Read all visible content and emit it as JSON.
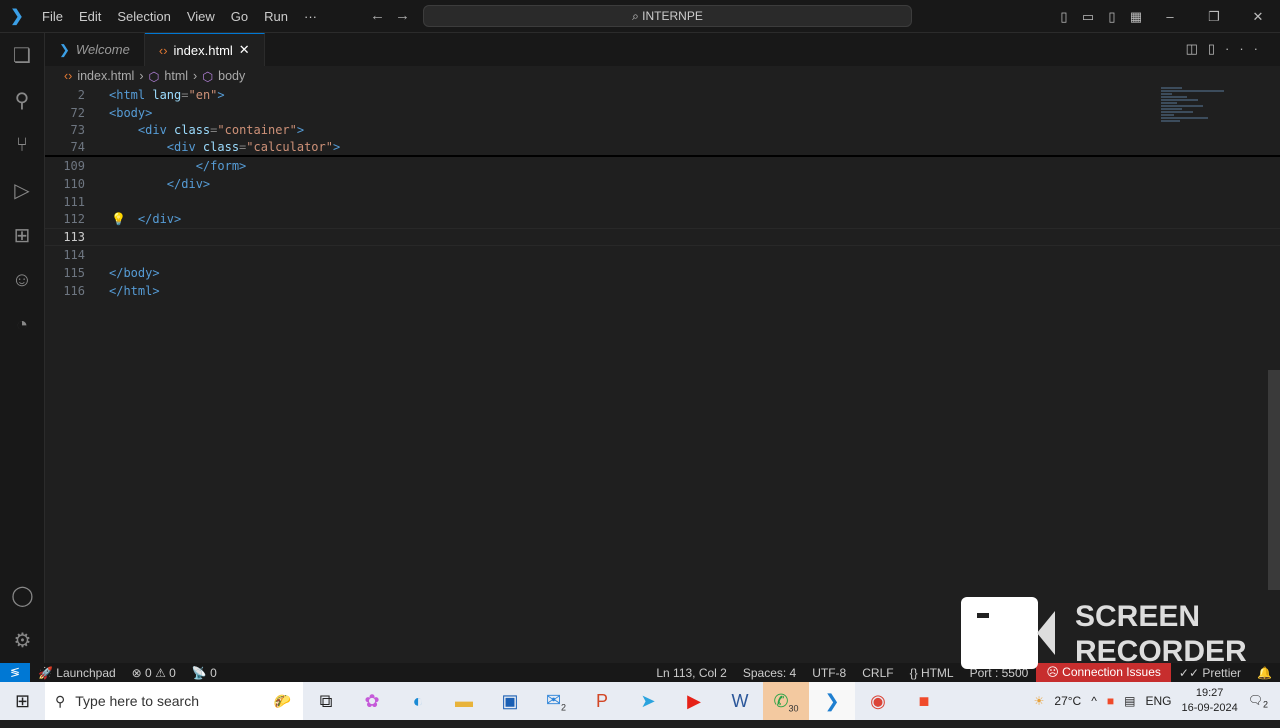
{
  "menu": [
    "File",
    "Edit",
    "Selection",
    "View",
    "Go",
    "Run",
    "···"
  ],
  "command_center": "⌕ INTERNPE",
  "tabs": [
    {
      "label": "Welcome"
    },
    {
      "label": "index.html",
      "close": "✕"
    }
  ],
  "breadcrumb": [
    "index.html",
    "html",
    "body"
  ],
  "lines": [
    {
      "n": "2",
      "parts": [
        [
          "tag",
          "<html "
        ],
        [
          "attr",
          "lang"
        ],
        [
          "br",
          "="
        ],
        [
          "str",
          "\"en\""
        ],
        [
          "tag",
          ">"
        ]
      ]
    },
    {
      "n": "72",
      "parts": [
        [
          "tag",
          "<body>"
        ]
      ]
    },
    {
      "n": "73",
      "parts": [
        [
          "tag",
          "    <div "
        ],
        [
          "attr",
          "class"
        ],
        [
          "br",
          "="
        ],
        [
          "str",
          "\"container\""
        ],
        [
          "tag",
          ">"
        ]
      ]
    },
    {
      "n": "74",
      "parts": [
        [
          "tag",
          "        <div "
        ],
        [
          "attr",
          "class"
        ],
        [
          "br",
          "="
        ],
        [
          "str",
          "\"calculator\""
        ],
        [
          "tag",
          ">"
        ]
      ]
    },
    {
      "n": "109",
      "parts": [
        [
          "tag",
          "            </form>"
        ]
      ]
    },
    {
      "n": "110",
      "parts": [
        [
          "tag",
          "        </div>"
        ]
      ]
    },
    {
      "n": "111",
      "parts": []
    },
    {
      "n": "112",
      "parts": [
        [
          "tag",
          "    </div>"
        ]
      ]
    },
    {
      "n": "113",
      "parts": []
    },
    {
      "n": "114",
      "parts": []
    },
    {
      "n": "115",
      "parts": [
        [
          "tag",
          "</body>"
        ]
      ]
    },
    {
      "n": "116",
      "parts": [
        [
          "tag",
          "</html>"
        ]
      ]
    }
  ],
  "status": {
    "launchpad": "Launchpad",
    "problems": "⊗ 0 ⚠ 0",
    "ports": "0",
    "position": "Ln 113, Col 2",
    "spaces": "Spaces: 4",
    "encoding": "UTF-8",
    "eol": "CRLF",
    "language": "HTML",
    "port": "Port : 5500",
    "connection": "Connection Issues",
    "prettier": "Prettier"
  },
  "taskbar": {
    "search_placeholder": "Type here to search",
    "mail_badge": "2",
    "whatsapp_badge": "30",
    "weather": "27°C",
    "lang": "ENG",
    "time": "19:27",
    "date": "16-09-2024",
    "notif_badge": "2"
  },
  "recorder": {
    "line1": "SCREEN",
    "line2": "RECORDER"
  }
}
